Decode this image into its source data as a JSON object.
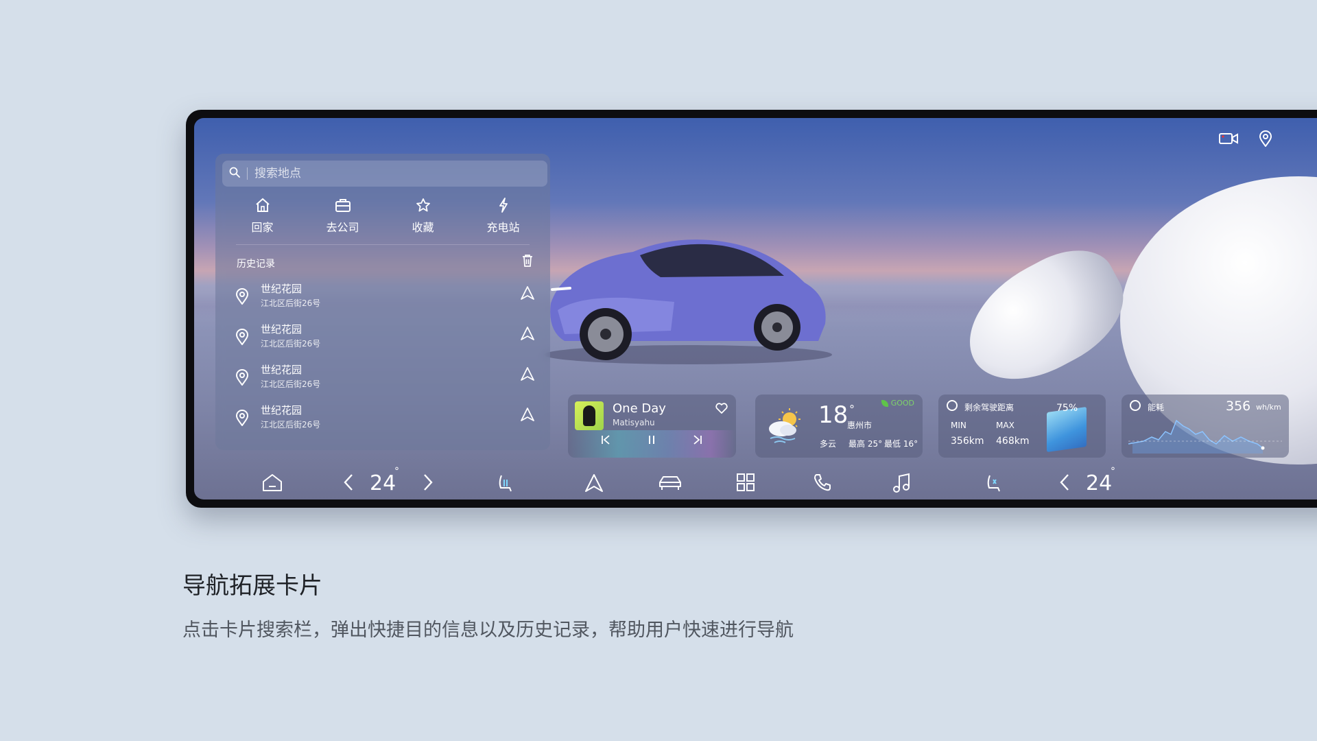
{
  "nav_card": {
    "search_placeholder": "搜索地点",
    "quick": [
      {
        "label": "回家",
        "icon": "home-icon"
      },
      {
        "label": "去公司",
        "icon": "briefcase-icon"
      },
      {
        "label": "收藏",
        "icon": "star-icon"
      },
      {
        "label": "充电站",
        "icon": "bolt-icon"
      }
    ],
    "history_title": "历史记录",
    "history": [
      {
        "name": "世纪花园",
        "addr": "江北区后街26号"
      },
      {
        "name": "世纪花园",
        "addr": "江北区后街26号"
      },
      {
        "name": "世纪花园",
        "addr": "江北区后街26号"
      },
      {
        "name": "世纪花园",
        "addr": "江北区后街26号"
      }
    ]
  },
  "music": {
    "title": "One Day",
    "artist": "Matisyahu"
  },
  "weather": {
    "temp": "18",
    "unit": "°",
    "city": "惠州市",
    "condition": "多云",
    "high": "最高 25°",
    "low": "最低 16°",
    "aqi": "GOOD"
  },
  "range": {
    "title": "剩余驾驶距离",
    "min_label": "MIN",
    "max_label": "MAX",
    "min_value": "356km",
    "max_value": "468km",
    "battery": "75%",
    "battery_level": 0.75
  },
  "energy": {
    "title": "能耗",
    "value": "356",
    "unit": "wh/km"
  },
  "dock": {
    "temp_left": "24",
    "temp_right": "24",
    "deg": "°"
  },
  "caption": {
    "title": "导航拓展卡片",
    "subtitle": "点击卡片搜索栏，弹出快捷目的信息以及历史记录，帮助用户快速进行导航"
  },
  "colors": {
    "accent_green": "#7fd36a",
    "background": "#d5dfea"
  }
}
